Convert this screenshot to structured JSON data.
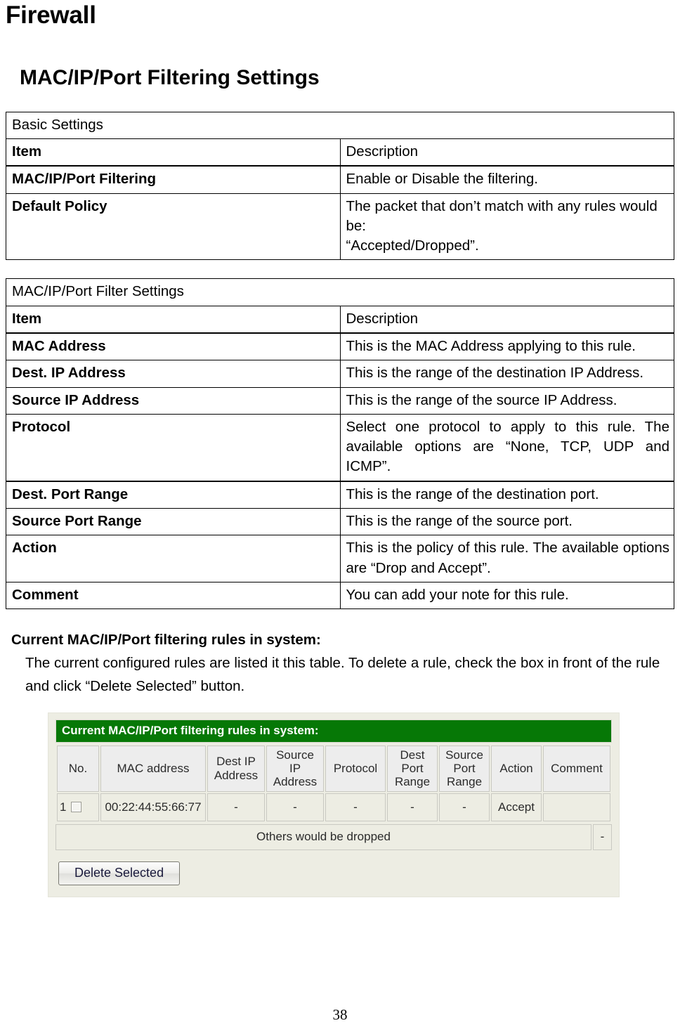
{
  "document": {
    "title": "Firewall",
    "section_title": "MAC/IP/Port Filtering Settings",
    "page_number": "38"
  },
  "basic_settings_table": {
    "banner": "Basic Settings",
    "col_item": "Item",
    "col_description": "Description",
    "rows": [
      {
        "item": "MAC/IP/Port Filtering",
        "description": "Enable or Disable the filtering."
      },
      {
        "item": "Default Policy",
        "description_line1": "The packet that don’t match with any rules would be:",
        "description_line2": "“Accepted/Dropped”."
      }
    ]
  },
  "filter_settings_table": {
    "banner": "MAC/IP/Port Filter Settings",
    "col_item": "Item",
    "col_description": "Description",
    "rows": [
      {
        "item": "MAC Address",
        "description": "This is the MAC Address applying to this rule."
      },
      {
        "item": "Dest. IP Address",
        "description": "This is the range of the destination IP Address."
      },
      {
        "item": "Source IP Address",
        "description": "This is the range of the source IP Address."
      },
      {
        "item": "Protocol",
        "description": "Select one protocol to apply to this rule. The available options are “None, TCP, UDP and ICMP”."
      },
      {
        "item": "Dest. Port Range",
        "description": "This is the range of the destination port."
      },
      {
        "item": "Source Port Range",
        "description": "This is the range of the source port."
      },
      {
        "item": "Action",
        "description": "This is the policy of this rule. The available options are “Drop and Accept”."
      },
      {
        "item": "Comment",
        "description": "You can add your note for this rule."
      }
    ]
  },
  "body": {
    "heading": "Current MAC/IP/Port filtering rules in system:",
    "paragraph": "The current configured rules are listed it this table. To delete a rule, check the box in front of the rule and click “Delete Selected” button."
  },
  "screenshot": {
    "banner": "Current MAC/IP/Port filtering rules in system:",
    "banner_bg": "#067806",
    "banner_fg": "#ffffff",
    "panel_bg": "#EDEDE3",
    "headers": [
      "No.",
      "MAC address",
      "Dest IP Address",
      "Source IP Address",
      "Protocol",
      "Dest Port Range",
      "Source Port Range",
      "Action",
      "Comment"
    ],
    "rows": [
      {
        "no": "1",
        "mac_address": "00:22:44:55:66:77",
        "dest_ip": "-",
        "source_ip": "-",
        "protocol": "-",
        "dest_port": "-",
        "source_port": "-",
        "action": "Accept",
        "comment": ""
      }
    ],
    "footer_text": "Others would be dropped",
    "footer_dash": "-",
    "delete_button": "Delete Selected"
  }
}
